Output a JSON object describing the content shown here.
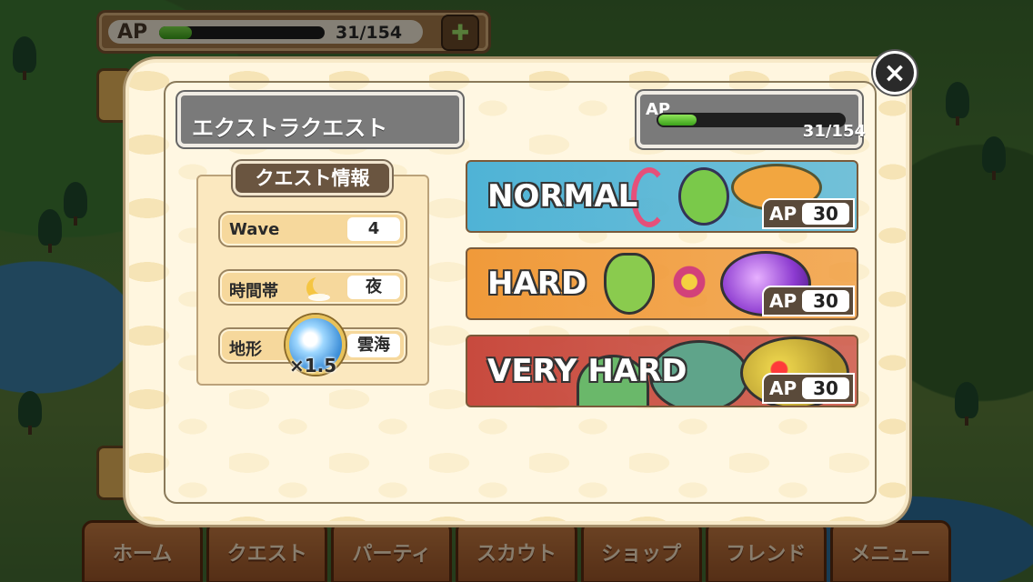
{
  "top_bar": {
    "ap_label": "AP",
    "ap_value": "31/154",
    "ap_fraction": 0.2
  },
  "bottom_nav": [
    {
      "label": "ホーム"
    },
    {
      "label": "クエスト"
    },
    {
      "label": "パーティ"
    },
    {
      "label": "スカウト"
    },
    {
      "label": "ショップ"
    },
    {
      "label": "フレンド"
    },
    {
      "label": "メニュー"
    }
  ],
  "modal": {
    "title": "エクストラクエスト",
    "close_symbol": "×",
    "ap_label": "AP",
    "ap_value": "31/154",
    "ap_fraction": 0.2,
    "info_title": "クエスト情報",
    "info": {
      "wave_label": "Wave",
      "wave_value": "4",
      "time_label": "時間帯",
      "time_value": "夜",
      "terrain_label": "地形",
      "terrain_value": "雲海",
      "terrain_multiplier": "×1.5"
    },
    "difficulties": [
      {
        "name": "NORMAL",
        "ap_label": "AP",
        "ap_cost": "30",
        "color": "#4fb3d6"
      },
      {
        "name": "HARD",
        "ap_label": "AP",
        "ap_cost": "30",
        "color": "#f09a3a"
      },
      {
        "name": "VERY HARD",
        "ap_label": "AP",
        "ap_cost": "30",
        "color": "#c84a3e"
      }
    ]
  }
}
